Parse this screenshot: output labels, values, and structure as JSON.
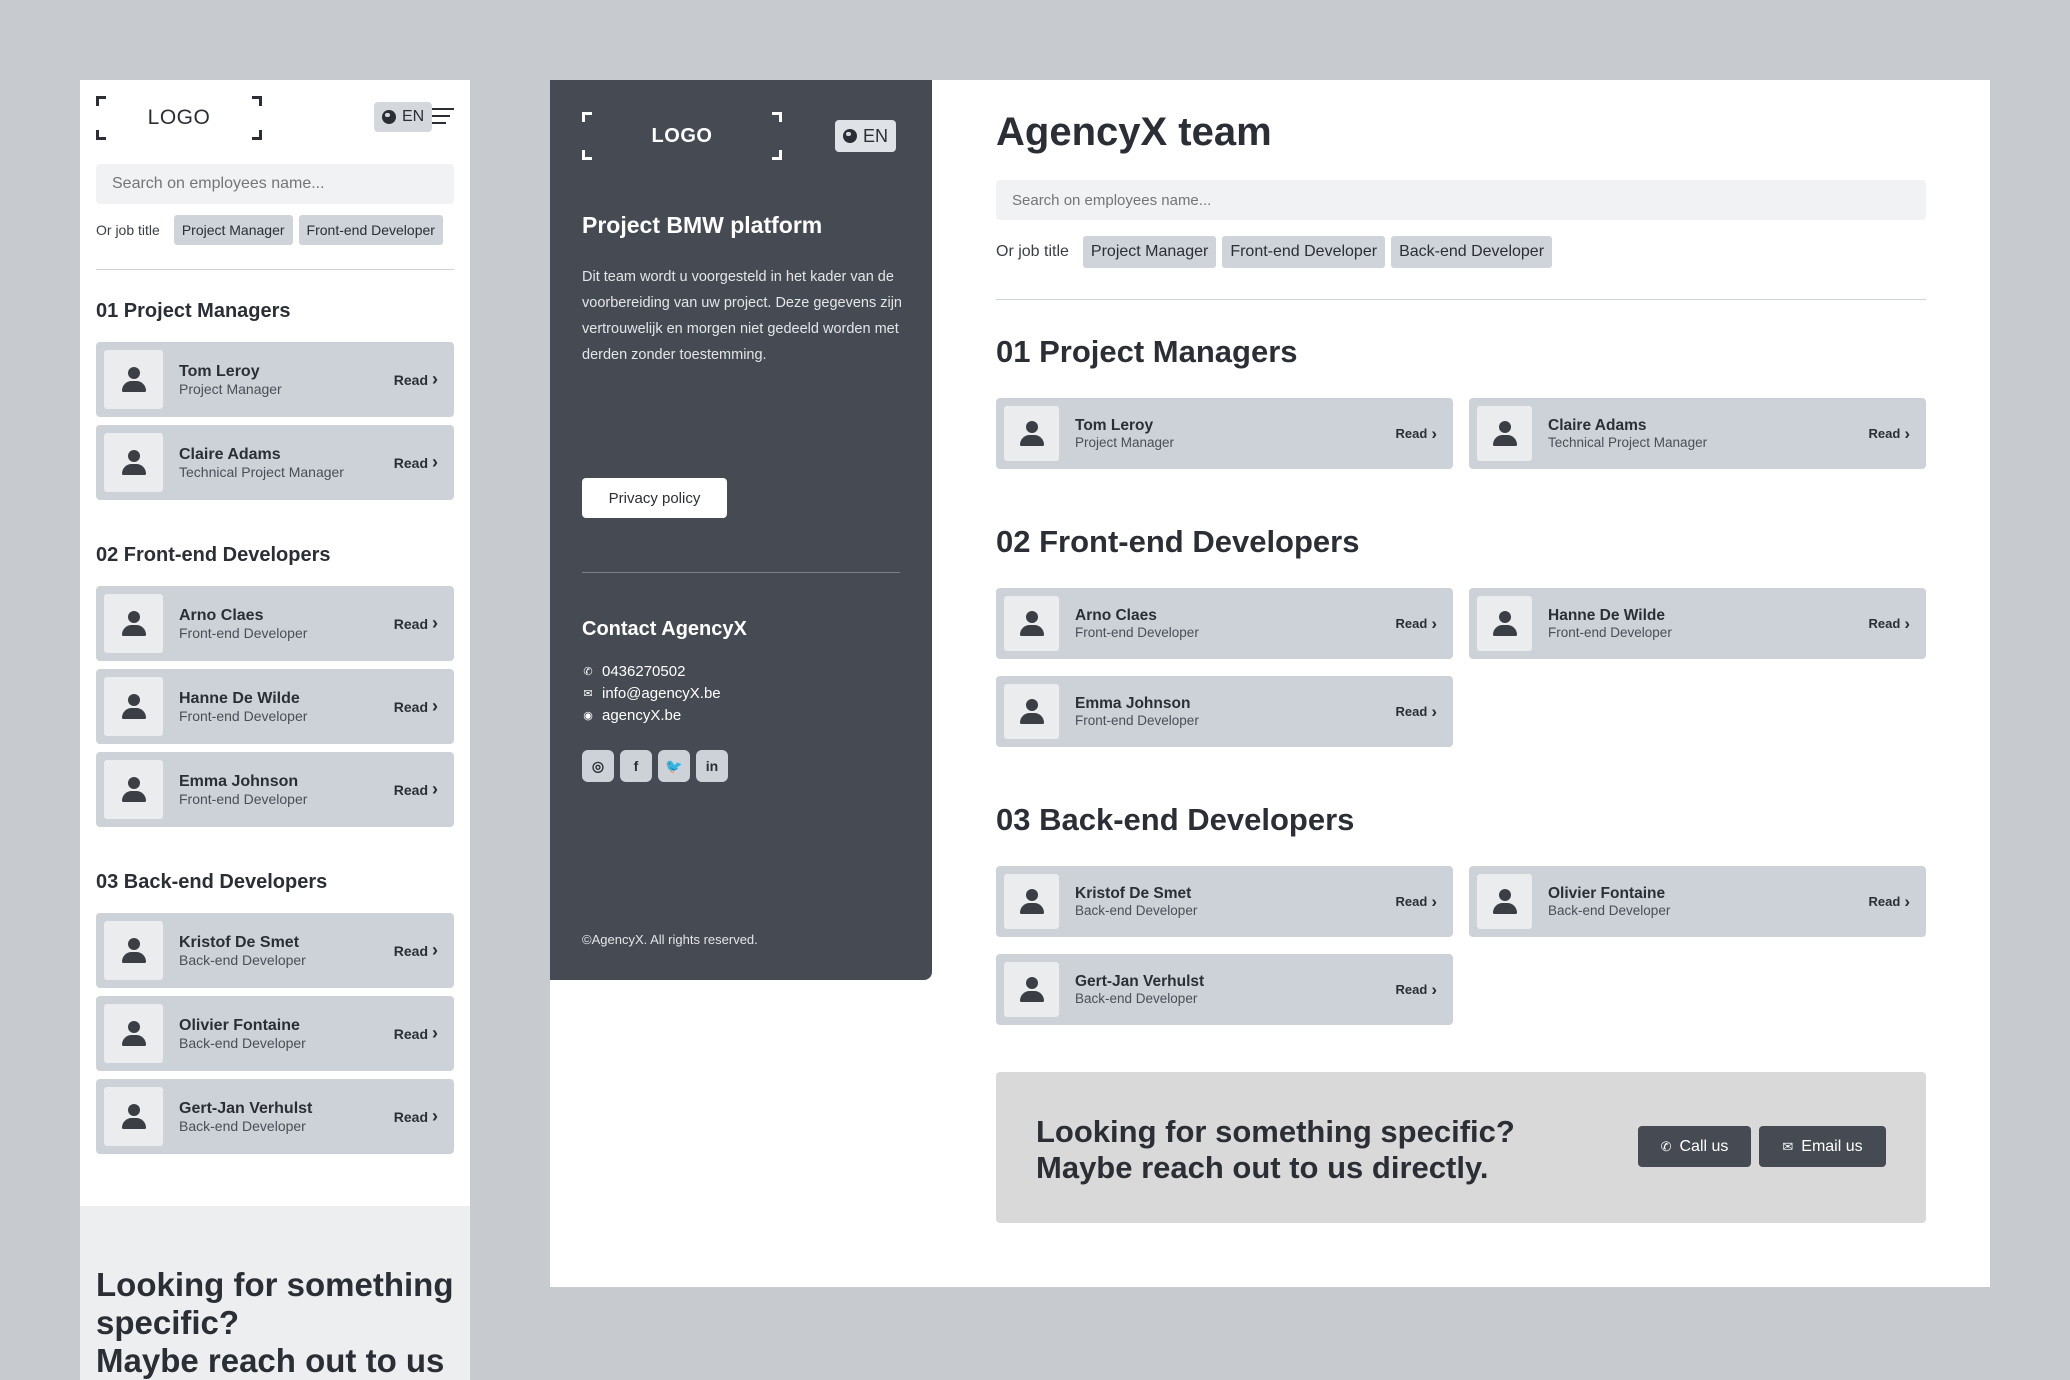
{
  "brand": {
    "logo": "LOGO",
    "language": "EN"
  },
  "search": {
    "placeholder": "Search on employees name..."
  },
  "filters": {
    "label": "Or job title",
    "mobile_chips": [
      "Project Manager",
      "Front-end Developer"
    ],
    "desktop_chips": [
      "Project Manager",
      "Front-end Developer",
      "Back-end Developer"
    ]
  },
  "team_title": "AgencyX team",
  "read_label": "Read",
  "sections": [
    {
      "title": "01 Project Managers",
      "members": [
        {
          "name": "Tom Leroy",
          "role": "Project Manager"
        },
        {
          "name": "Claire Adams",
          "role": "Technical Project Manager"
        }
      ]
    },
    {
      "title": "02 Front-end Developers",
      "members": [
        {
          "name": "Arno Claes",
          "role": "Front-end Developer"
        },
        {
          "name": "Hanne De Wilde",
          "role": "Front-end Developer"
        },
        {
          "name": "Emma Johnson",
          "role": "Front-end Developer"
        }
      ]
    },
    {
      "title": "03 Back-end Developers",
      "members": [
        {
          "name": "Kristof De Smet",
          "role": "Back-end Developer"
        },
        {
          "name": "Olivier Fontaine",
          "role": "Back-end Developer"
        },
        {
          "name": "Gert-Jan Verhulst",
          "role": "Back-end Developer"
        }
      ]
    }
  ],
  "panel": {
    "project_title": "Project BMW platform",
    "description": "Dit team wordt u voorgesteld in het kader van de voorbereiding van uw project. Deze gegevens zijn vertrouwelijk en morgen niet gedeeld worden met derden zonder toestemming.",
    "privacy_label": "Privacy policy",
    "contact_title": "Contact AgencyX",
    "phone": "0436270502",
    "email": "info@agencyX.be",
    "website": "agencyX.be",
    "socials": [
      "instagram-icon",
      "facebook-icon",
      "twitter-icon",
      "linkedin-icon"
    ],
    "copyright": "©AgencyX. All rights reserved."
  },
  "cta": {
    "line1": "Looking for something specific?",
    "line2": "Maybe reach out to us directly.",
    "mobile_line1": "Looking for something specific?",
    "mobile_line2": "Maybe reach out to us",
    "call_label": "Call us",
    "email_label": "Email us"
  }
}
